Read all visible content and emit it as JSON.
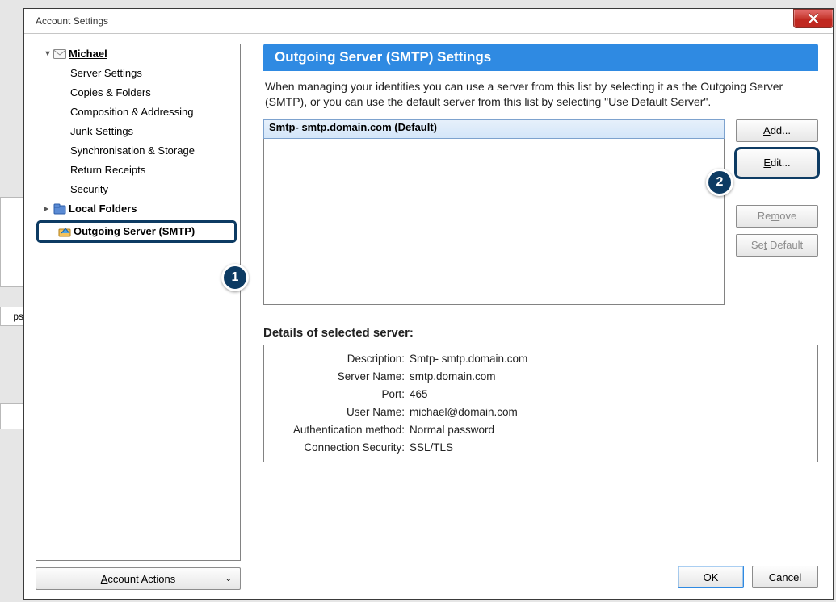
{
  "window": {
    "title": "Account Settings"
  },
  "tree": {
    "account": "Michael",
    "items": [
      "Server Settings",
      "Copies & Folders",
      "Composition & Addressing",
      "Junk Settings",
      "Synchronisation & Storage",
      "Return Receipts",
      "Security"
    ],
    "local_folders": "Local Folders",
    "smtp": "Outgoing Server (SMTP)",
    "account_actions_prefix": "A",
    "account_actions_rest": "ccount Actions"
  },
  "panel": {
    "title": "Outgoing Server (SMTP) Settings",
    "description": "When managing your identities you can use a server from this list by selecting it as the Outgoing Server (SMTP), or you can use the default server from this list by selecting \"Use Default Server\".",
    "server_entry": "Smtp- smtp.domain.com (Default)",
    "buttons": {
      "add_prefix": "A",
      "add_rest": "dd...",
      "edit_prefix": "E",
      "edit_rest": "dit...",
      "remove_pre": "Re",
      "remove_u": "m",
      "remove_post": "ove",
      "default_pre": "Se",
      "default_u": "t",
      "default_post": " Default"
    }
  },
  "details": {
    "heading": "Details of selected server:",
    "rows": [
      {
        "k": "Description:",
        "v": "Smtp- smtp.domain.com"
      },
      {
        "k": "Server Name:",
        "v": "smtp.domain.com"
      },
      {
        "k": "Port:",
        "v": "465"
      },
      {
        "k": "User Name:",
        "v": "michael@domain.com"
      },
      {
        "k": "Authentication method:",
        "v": "Normal password"
      },
      {
        "k": "Connection Security:",
        "v": "SSL/TLS"
      }
    ]
  },
  "footer": {
    "ok": "OK",
    "cancel": "Cancel"
  },
  "badges": {
    "one": "1",
    "two": "2"
  }
}
